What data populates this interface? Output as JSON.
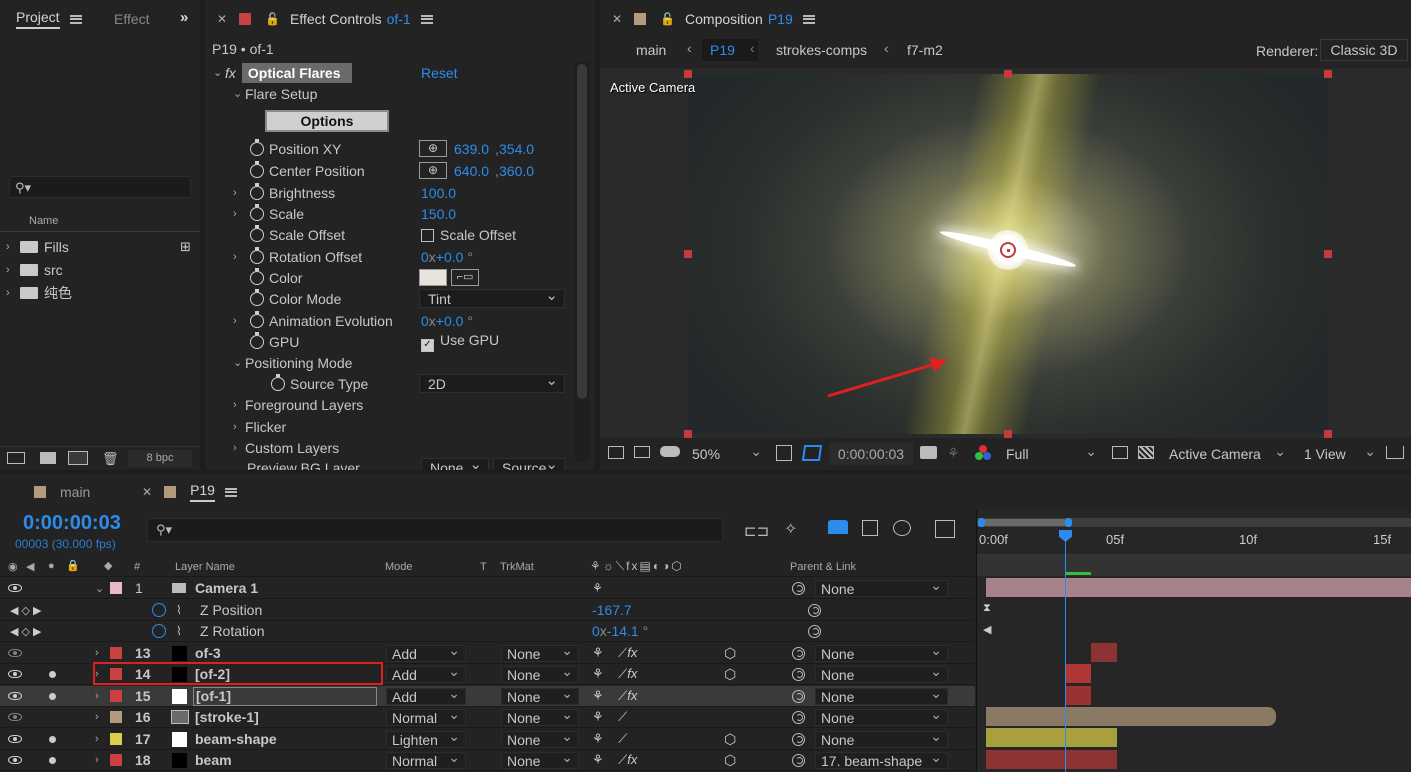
{
  "project_panel": {
    "tab_project": "Project",
    "tab_effect": "Effect",
    "col_name": "Name",
    "items": [
      {
        "label": "Fills"
      },
      {
        "label": "src"
      },
      {
        "label": "纯色"
      }
    ],
    "bpc": "8 bpc"
  },
  "effect_controls": {
    "tab_label": "Effect Controls",
    "tab_layer": "of-1",
    "breadcrumb": "P19 • of-1",
    "effect_name": "Optical Flares",
    "reset": "Reset",
    "flare_setup": "Flare Setup",
    "options_btn": "Options",
    "props": {
      "position_xy": {
        "label": "Position XY",
        "x": "639.0",
        "y": "354.0"
      },
      "center_position": {
        "label": "Center Position",
        "x": "640.0",
        "y": "360.0"
      },
      "brightness": {
        "label": "Brightness",
        "value": "100.0"
      },
      "scale": {
        "label": "Scale",
        "value": "150.0"
      },
      "scale_offset": {
        "label": "Scale Offset",
        "checkbox": "Scale Offset"
      },
      "rotation_offset": {
        "label": "Rotation Offset",
        "turns": "0",
        "deg": "+0.0"
      },
      "color": {
        "label": "Color"
      },
      "color_mode": {
        "label": "Color Mode",
        "value": "Tint"
      },
      "animation_evolution": {
        "label": "Animation Evolution",
        "turns": "0",
        "deg": "+0.0"
      },
      "gpu": {
        "label": "GPU",
        "checkbox": "Use GPU"
      },
      "positioning_mode": {
        "label": "Positioning Mode"
      },
      "source_type": {
        "label": "Source Type",
        "value": "2D"
      },
      "foreground_layers": {
        "label": "Foreground Layers"
      },
      "flicker": {
        "label": "Flicker"
      },
      "custom_layers": {
        "label": "Custom Layers"
      },
      "preview_bg": {
        "label": "Preview BG Layer",
        "v1": "None",
        "v2": "Source"
      }
    },
    "x_unit": "x",
    "deg_unit": "°",
    "comma": ","
  },
  "composition": {
    "tab_label": "Composition",
    "tab_comp": "P19",
    "nav": [
      "main",
      "P19",
      "strokes-comps",
      "f7-m2"
    ],
    "renderer_label": "Renderer:",
    "renderer_value": "Classic 3D",
    "viewer_label": "Active Camera",
    "zoom": "50%",
    "timecode": "0:00:00:03",
    "resolution": "Full",
    "view_camera": "Active Camera",
    "views": "1 View"
  },
  "timeline": {
    "tab_main": "main",
    "tab_p19": "P19",
    "timecode": "0:00:00:03",
    "frames": "00003 (30.000 fps)",
    "col_hash": "#",
    "col_layer_name": "Layer Name",
    "col_mode": "Mode",
    "col_t": "T",
    "col_trkmat": "TrkMat",
    "col_parent": "Parent & Link",
    "ruler": [
      "0:00f",
      "05f",
      "10f",
      "15f"
    ],
    "layers": [
      {
        "num": "1",
        "name": "Camera 1",
        "color": "#e8b9c7",
        "parent": "None"
      },
      {
        "num": "13",
        "name": "of-3",
        "color": "#c94141",
        "mode": "Add",
        "trkmat": "None",
        "parent": "None"
      },
      {
        "num": "14",
        "name": "[of-2]",
        "color": "#c94141",
        "mode": "Add",
        "trkmat": "None",
        "parent": "None"
      },
      {
        "num": "15",
        "name": "[of-1]",
        "color": "#c94141",
        "mode": "Add",
        "trkmat": "None",
        "parent": "None"
      },
      {
        "num": "16",
        "name": "[stroke-1]",
        "color": "#b39a7a",
        "mode": "Normal",
        "trkmat": "None",
        "parent": "None"
      },
      {
        "num": "17",
        "name": "beam-shape",
        "color": "#d9cf4a",
        "mode": "Lighten",
        "trkmat": "None",
        "parent": "None"
      },
      {
        "num": "18",
        "name": "beam",
        "color": "#c94141",
        "mode": "Normal",
        "trkmat": "None",
        "parent": "17. beam-shape"
      }
    ],
    "z_position": {
      "label": "Z Position",
      "value": "-167.7"
    },
    "z_rotation": {
      "label": "Z Rotation",
      "turns": "0",
      "deg": "-14.1"
    }
  }
}
